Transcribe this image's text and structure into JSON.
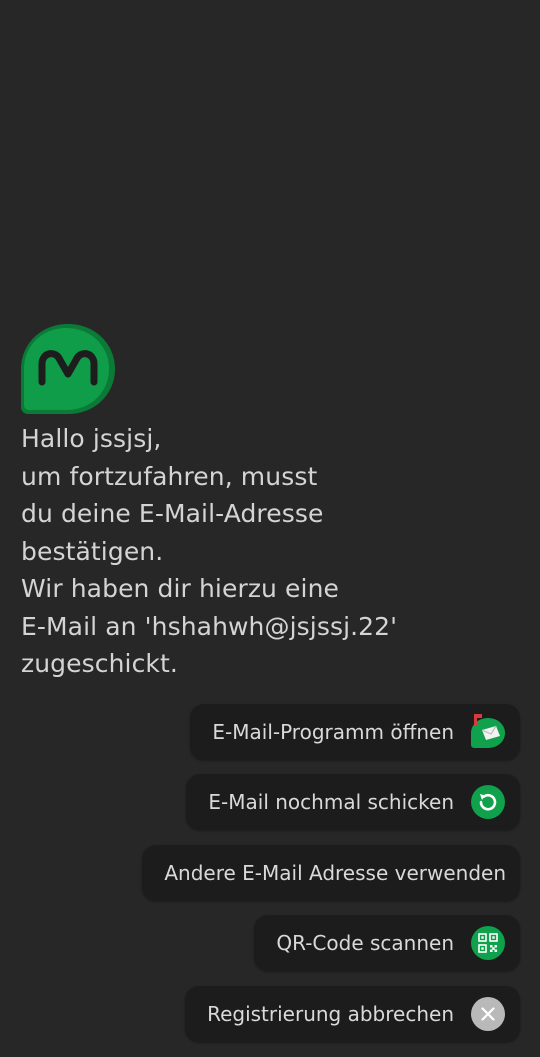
{
  "app": {
    "logo_icon": "m-chat-bubble-logo-icon",
    "accent_color": "#0fa14b",
    "accent_dark": "#0b7a37"
  },
  "message": {
    "lines": [
      "Hallo jssjsj,",
      "um fortzufahren, musst",
      "du deine E-Mail-Adresse",
      "bestätigen.",
      "Wir haben dir hierzu eine",
      "E-Mail an 'hshahwh@jsjssj.22'",
      "zugeschickt."
    ]
  },
  "actions": [
    {
      "label": "E-Mail-Programm öffnen",
      "icon": "mailbox-icon"
    },
    {
      "label": "E-Mail nochmal schicken",
      "icon": "resend-icon"
    },
    {
      "label": "Andere E-Mail Adresse verwenden",
      "icon": ""
    },
    {
      "label": "QR-Code scannen",
      "icon": "qr-code-icon"
    },
    {
      "label": "Registrierung abbrechen",
      "icon": "close-icon"
    }
  ]
}
